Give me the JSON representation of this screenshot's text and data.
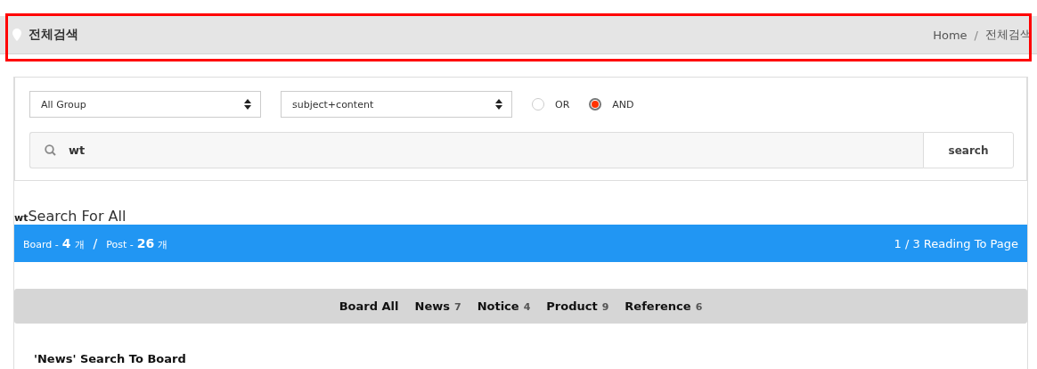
{
  "header": {
    "title": "전체검색",
    "breadcrumb": [
      "Home",
      "전체검색"
    ],
    "breadcrumb_separator": "/",
    "highlighted": true
  },
  "search": {
    "group_select": "All Group",
    "field_select": "subject+content",
    "modes": [
      {
        "label": "OR",
        "selected": false
      },
      {
        "label": "AND",
        "selected": true
      }
    ],
    "query": "wt",
    "button": "search"
  },
  "results": {
    "keyword": "wt",
    "title": "Search For All",
    "summary": {
      "board_label": "Board -",
      "board_count": "4",
      "board_unit": "개",
      "separator": "/",
      "post_label": "Post -",
      "post_count": "26",
      "post_unit": "개",
      "paging": "1 / 3 Reading To Page"
    },
    "tabs": [
      {
        "label": "Board All"
      },
      {
        "label": "News",
        "count": "7"
      },
      {
        "label": "Notice",
        "count": "4"
      },
      {
        "label": "Product",
        "count": "9"
      },
      {
        "label": "Reference",
        "count": "6"
      }
    ],
    "section_title": "'News' Search To Board"
  }
}
